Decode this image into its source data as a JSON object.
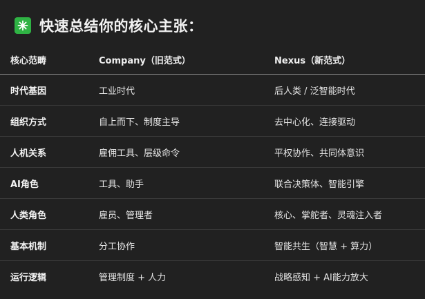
{
  "heading": {
    "icon": "sparkle-icon",
    "icon_color": "#2fb344",
    "text": "快速总结你的核心主张："
  },
  "table": {
    "headers": [
      "核心范畴",
      "Company（旧范式）",
      "Nexus（新范式）"
    ],
    "rows": [
      [
        "时代基因",
        "工业时代",
        "后人类 / 泛智能时代"
      ],
      [
        "组织方式",
        "自上而下、制度主导",
        "去中心化、连接驱动"
      ],
      [
        "人机关系",
        "雇佣工具、层级命令",
        "平权协作、共同体意识"
      ],
      [
        "AI角色",
        "工具、助手",
        "联合决策体、智能引擎"
      ],
      [
        "人类角色",
        "雇员、管理者",
        "核心、掌舵者、灵魂注入者"
      ],
      [
        "基本机制",
        "分工协作",
        "智能共生（智慧 + 算力）"
      ],
      [
        "运行逻辑",
        "管理制度 + 人力",
        "战略感知 + AI能力放大"
      ]
    ]
  }
}
